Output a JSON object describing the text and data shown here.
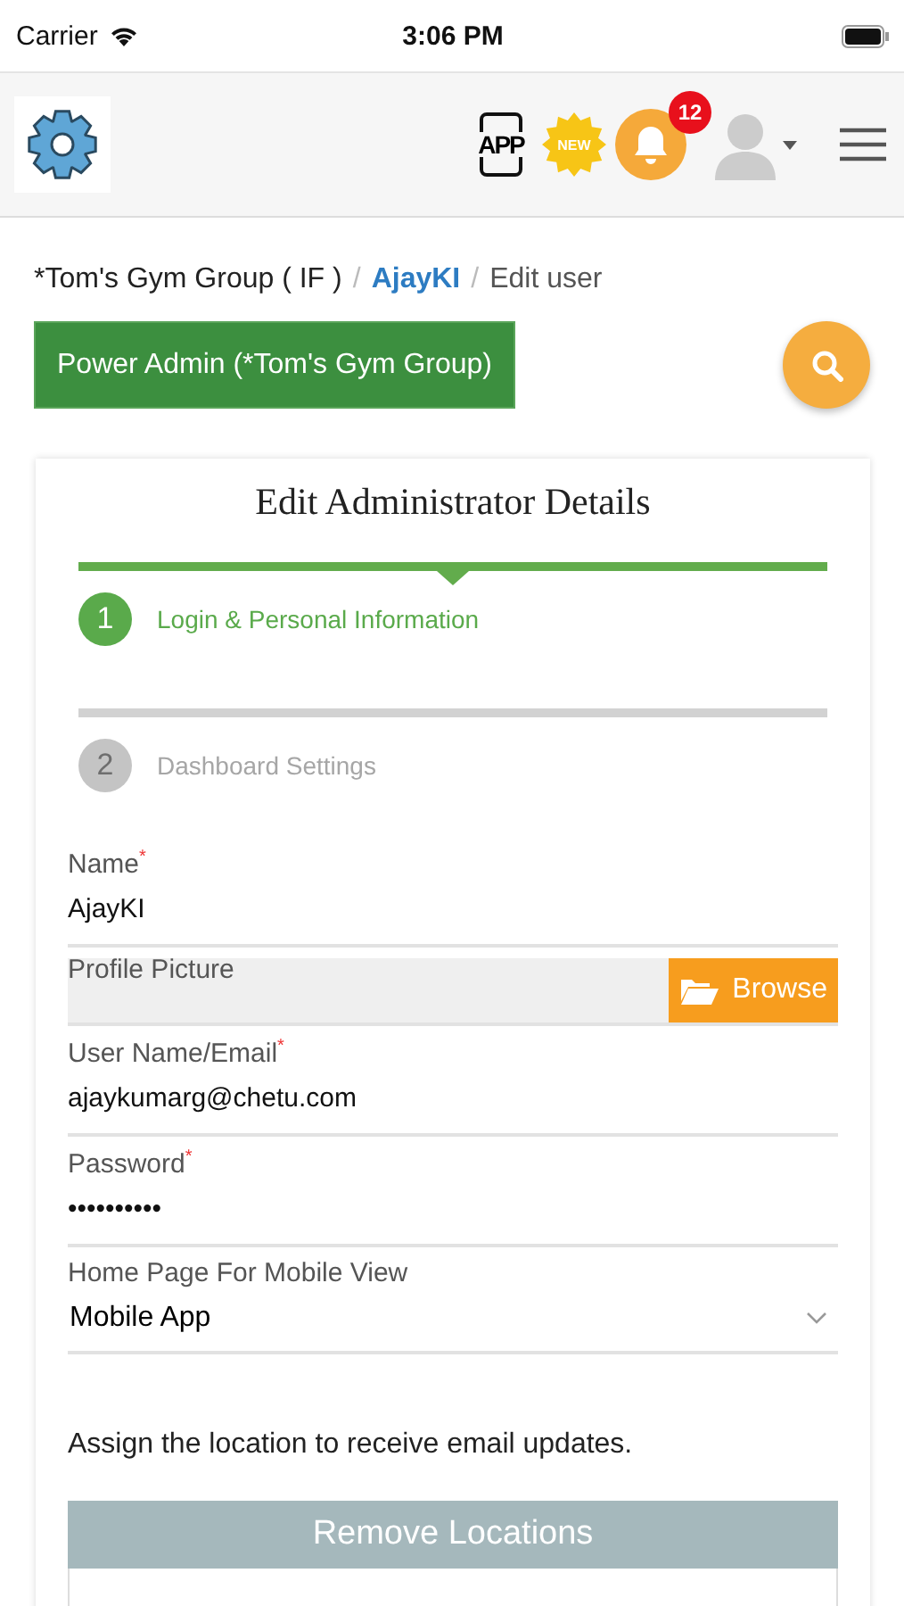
{
  "status_bar": {
    "carrier": "Carrier",
    "time": "3:06 PM"
  },
  "header": {
    "app_label": "APP",
    "new_badge": "NEW",
    "notification_count": "12"
  },
  "breadcrumb_separator": "/",
  "breadcrumb": [
    {
      "label": "*Tom's Gym Group ( IF )",
      "kind": "root"
    },
    {
      "label": "AjayKI",
      "kind": "link"
    },
    {
      "label": "Edit user",
      "kind": "current"
    }
  ],
  "role_button": "Power Admin (*Tom's Gym Group)",
  "card": {
    "title": "Edit Administrator Details",
    "steps": [
      {
        "number": "1",
        "label": "Login & Personal Information",
        "selected": true
      },
      {
        "number": "2",
        "label": "Dashboard Settings",
        "selected": false
      }
    ],
    "fields": [
      {
        "kind": "text",
        "label": "Name",
        "mark": "*",
        "value": "AjayKI"
      },
      {
        "kind": "file",
        "label": "Profile Picture",
        "button": "Browse"
      },
      {
        "kind": "text",
        "label": "User Name/Email",
        "mark": "*",
        "value": "ajaykumarg@chetu.com"
      },
      {
        "kind": "text",
        "label": "Password",
        "mark": "*",
        "value": "••••••••••"
      },
      {
        "kind": "select",
        "label": "Home Page For Mobile View",
        "value": "Mobile App"
      }
    ],
    "note": "Assign the location to receive email updates.",
    "locations_header": "Remove Locations"
  }
}
